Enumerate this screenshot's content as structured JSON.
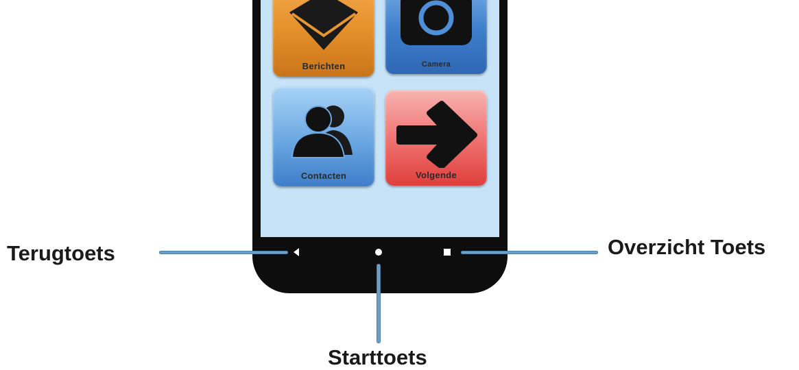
{
  "tiles": {
    "berichten": "Berichten",
    "camera": "Camera",
    "contacten": "Contacten",
    "volgende": "Volgende"
  },
  "callouts": {
    "back": "Terugtoets",
    "home": "Starttoets",
    "recent": "Overzicht Toets"
  },
  "colors": {
    "callout_line": "#6b9fc8",
    "screen_bg": "#c6e3f7",
    "phone_body": "#0d0d0d"
  },
  "icons": [
    "envelope-icon",
    "camera-icon",
    "contacts-icon",
    "arrow-right-icon",
    "back-icon",
    "home-icon",
    "recent-apps-icon"
  ]
}
